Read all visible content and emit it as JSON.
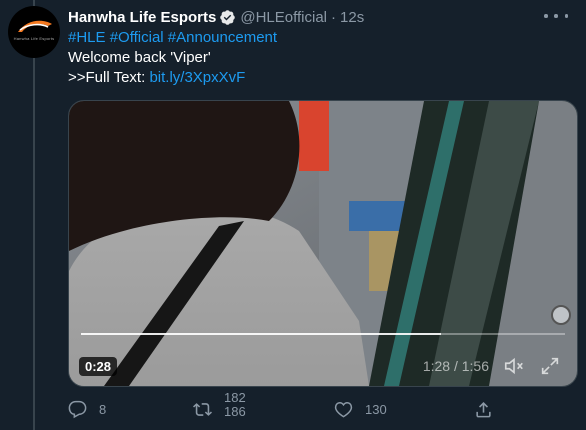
{
  "tweet": {
    "author_name": "Hanwha Life Esports",
    "handle": "@HLEofficial",
    "separator": "·",
    "time": "12s",
    "avatar_text": "Hanwha Life Esports",
    "hashtags": [
      "#HLE",
      "#Official",
      "#Announcement"
    ],
    "line2": "Welcome back 'Viper'",
    "fulltext_prefix": ">>Full Text: ",
    "fulltext_link": "bit.ly/3XpxXvF"
  },
  "video": {
    "elapsed": "0:28",
    "time_total": "1:28 / 1:56",
    "progress_fraction": 0.744
  },
  "actions": {
    "replies": "8",
    "retweets_prev": "182",
    "retweets": "186",
    "likes": "130"
  },
  "colors": {
    "background": "#15202b",
    "link": "#1d9bf0",
    "muted": "#8b98a5",
    "verified": "#1d9bf0"
  }
}
